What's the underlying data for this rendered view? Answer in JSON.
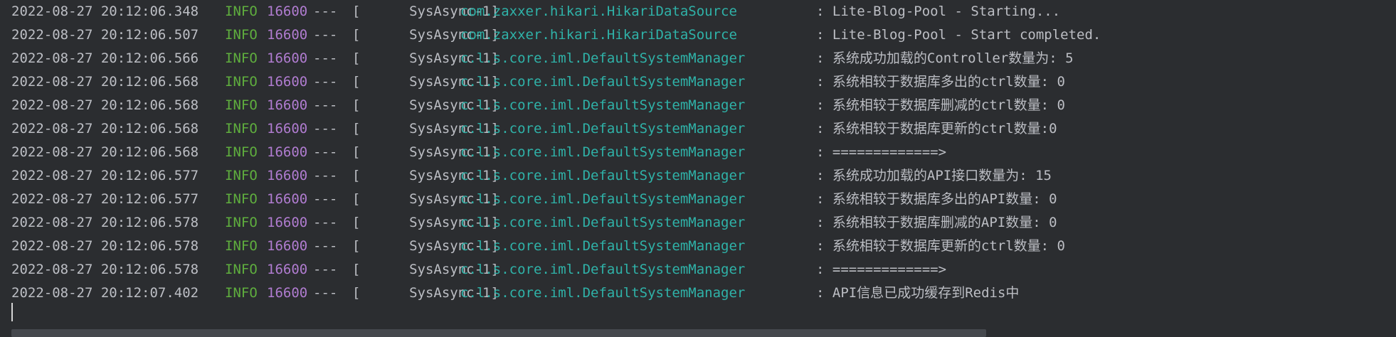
{
  "console": {
    "lines": [
      {
        "ts": "2022-08-27 20:12:06.348",
        "level": "INFO",
        "pid": "16600",
        "sep": "---",
        "thread": "[      SysAsync-1]",
        "logger": "com.zaxxer.hikari.HikariDataSource",
        "message": ": Lite-Blog-Pool - Starting..."
      },
      {
        "ts": "2022-08-27 20:12:06.507",
        "level": "INFO",
        "pid": "16600",
        "sep": "---",
        "thread": "[      SysAsync-1]",
        "logger": "com.zaxxer.hikari.HikariDataSource",
        "message": ": Lite-Blog-Pool - Start completed."
      },
      {
        "ts": "2022-08-27 20:12:06.566",
        "level": "INFO",
        "pid": "16600",
        "sep": "---",
        "thread": "[      SysAsync-1]",
        "logger": "c.l.s.core.iml.DefaultSystemManager",
        "message": ": 系统成功加载的Controller数量为: 5"
      },
      {
        "ts": "2022-08-27 20:12:06.568",
        "level": "INFO",
        "pid": "16600",
        "sep": "---",
        "thread": "[      SysAsync-1]",
        "logger": "c.l.s.core.iml.DefaultSystemManager",
        "message": ": 系统相较于数据库多出的ctrl数量: 0"
      },
      {
        "ts": "2022-08-27 20:12:06.568",
        "level": "INFO",
        "pid": "16600",
        "sep": "---",
        "thread": "[      SysAsync-1]",
        "logger": "c.l.s.core.iml.DefaultSystemManager",
        "message": ": 系统相较于数据库删减的ctrl数量: 0"
      },
      {
        "ts": "2022-08-27 20:12:06.568",
        "level": "INFO",
        "pid": "16600",
        "sep": "---",
        "thread": "[      SysAsync-1]",
        "logger": "c.l.s.core.iml.DefaultSystemManager",
        "message": ": 系统相较于数据库更新的ctrl数量:0"
      },
      {
        "ts": "2022-08-27 20:12:06.568",
        "level": "INFO",
        "pid": "16600",
        "sep": "---",
        "thread": "[      SysAsync-1]",
        "logger": "c.l.s.core.iml.DefaultSystemManager",
        "message": ": =============>"
      },
      {
        "ts": "2022-08-27 20:12:06.577",
        "level": "INFO",
        "pid": "16600",
        "sep": "---",
        "thread": "[      SysAsync-1]",
        "logger": "c.l.s.core.iml.DefaultSystemManager",
        "message": ": 系统成功加载的API接口数量为: 15"
      },
      {
        "ts": "2022-08-27 20:12:06.577",
        "level": "INFO",
        "pid": "16600",
        "sep": "---",
        "thread": "[      SysAsync-1]",
        "logger": "c.l.s.core.iml.DefaultSystemManager",
        "message": ": 系统相较于数据库多出的API数量: 0"
      },
      {
        "ts": "2022-08-27 20:12:06.578",
        "level": "INFO",
        "pid": "16600",
        "sep": "---",
        "thread": "[      SysAsync-1]",
        "logger": "c.l.s.core.iml.DefaultSystemManager",
        "message": ": 系统相较于数据库删减的API数量: 0"
      },
      {
        "ts": "2022-08-27 20:12:06.578",
        "level": "INFO",
        "pid": "16600",
        "sep": "---",
        "thread": "[      SysAsync-1]",
        "logger": "c.l.s.core.iml.DefaultSystemManager",
        "message": ": 系统相较于数据库更新的ctrl数量: 0"
      },
      {
        "ts": "2022-08-27 20:12:06.578",
        "level": "INFO",
        "pid": "16600",
        "sep": "---",
        "thread": "[      SysAsync-1]",
        "logger": "c.l.s.core.iml.DefaultSystemManager",
        "message": ": =============>"
      },
      {
        "ts": "2022-08-27 20:12:07.402",
        "level": "INFO",
        "pid": "16600",
        "sep": "---",
        "thread": "[      SysAsync-1]",
        "logger": "c.l.s.core.iml.DefaultSystemManager",
        "message": ": API信息已成功缓存到Redis中"
      }
    ]
  },
  "colors": {
    "background": "#2b2d30",
    "text": "#bcbec4",
    "level_info": "#5fae3e",
    "pid": "#b07cd0",
    "logger": "#2fb2a8"
  }
}
